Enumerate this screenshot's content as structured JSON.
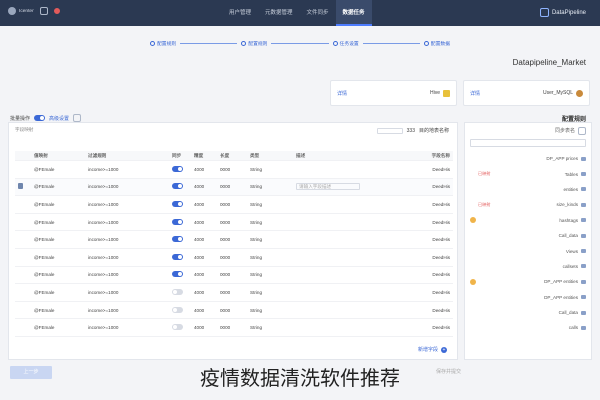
{
  "topbar": {
    "brand": "DataPipeline",
    "nav": [
      "数据任务",
      "文件同步",
      "元数据管理",
      "用户管理"
    ],
    "active_index": 0,
    "user": "Icenter"
  },
  "steps": [
    "配置数据",
    "任务设置",
    "配置规则",
    "配置规则"
  ],
  "page_title": "Datapipeline_Market",
  "sources": [
    {
      "name": "User_MySQL",
      "action": "详情",
      "logo": "mysql-logo"
    },
    {
      "name": "Hive",
      "action": "详情",
      "logo": "hive-logo"
    }
  ],
  "section_label": "配置规则",
  "left_header": {
    "mode_label": "高级设置",
    "toggle_label": "批量操作"
  },
  "panel": {
    "caption": "字段映射",
    "top_right_label": "目的地表名称",
    "top_right_value": "333"
  },
  "table": {
    "headers": [
      "",
      "值映射",
      "过滤规则",
      "同步",
      "精度",
      "长度",
      "类型",
      "描述",
      "字段名称"
    ],
    "rows": [
      {
        "mail": "@FEmale",
        "cond": "income>=1000",
        "sync": true,
        "prec": "4000",
        "len": "0000",
        "type": "String",
        "desc": "",
        "name": "DeedHis"
      },
      {
        "mail": "@FEmale",
        "cond": "income>=1000",
        "sync": true,
        "prec": "4000",
        "len": "0000",
        "type": "String",
        "desc": "请输入字段描述",
        "name": "DeedHis",
        "editing": true
      },
      {
        "mail": "@FEmale",
        "cond": "income>=1000",
        "sync": true,
        "prec": "4000",
        "len": "0000",
        "type": "String",
        "desc": "",
        "name": "DeedHis"
      },
      {
        "mail": "@FEmale",
        "cond": "income>=1000",
        "sync": true,
        "prec": "4000",
        "len": "0000",
        "type": "String",
        "desc": "",
        "name": "DeedHis"
      },
      {
        "mail": "@FEmale",
        "cond": "income>=1000",
        "sync": true,
        "prec": "4000",
        "len": "0000",
        "type": "String",
        "desc": "",
        "name": "DeedHis"
      },
      {
        "mail": "@FEmale",
        "cond": "income>=1000",
        "sync": true,
        "prec": "4000",
        "len": "0000",
        "type": "String",
        "desc": "",
        "name": "DeedHis"
      },
      {
        "mail": "@FEmale",
        "cond": "income>=1000",
        "sync": true,
        "prec": "4000",
        "len": "0000",
        "type": "String",
        "desc": "",
        "name": "DeedHis"
      },
      {
        "mail": "@FEmale",
        "cond": "income>=1000",
        "sync": false,
        "prec": "4000",
        "len": "0000",
        "type": "String",
        "desc": "",
        "name": "DeedHis"
      },
      {
        "mail": "@FEmale",
        "cond": "income>=1000",
        "sync": false,
        "prec": "4000",
        "len": "0000",
        "type": "String",
        "desc": "",
        "name": "DeedHis"
      },
      {
        "mail": "@FEmale",
        "cond": "income>=1000",
        "sync": false,
        "prec": "4000",
        "len": "0000",
        "type": "String",
        "desc": "",
        "name": "DeedHis"
      }
    ],
    "edit_placeholder_cond": "income>=1000",
    "edit_placeholder_mail": "@FEmale"
  },
  "add_row_label": "新增字段",
  "tree": {
    "header": "同步表名",
    "items": [
      {
        "label": "DP_APP prices",
        "badge": false,
        "tag": ""
      },
      {
        "label": "Tables",
        "badge": false,
        "tag": "已映射"
      },
      {
        "label": "entities",
        "badge": false,
        "tag": ""
      },
      {
        "label": "size_kinds",
        "badge": false,
        "tag": "已映射"
      },
      {
        "label": "hashtags",
        "badge": true,
        "tag": ""
      },
      {
        "label": "Call_data",
        "badge": false,
        "tag": ""
      },
      {
        "label": "Views",
        "badge": false,
        "tag": ""
      },
      {
        "label": "callsets",
        "badge": false,
        "tag": ""
      },
      {
        "label": "DP_APP entities",
        "badge": true,
        "tag": ""
      },
      {
        "label": "DP_APP entities",
        "badge": false,
        "tag": ""
      },
      {
        "label": "Call_data",
        "badge": false,
        "tag": ""
      },
      {
        "label": "calls",
        "badge": false,
        "tag": ""
      }
    ]
  },
  "footer": {
    "prev_label": "上一步",
    "next_label": "保存并提交"
  },
  "caption": "疫情数据清洗软件推荐"
}
